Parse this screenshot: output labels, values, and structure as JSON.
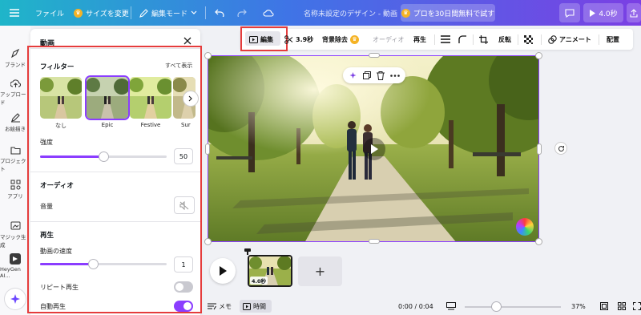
{
  "topbar": {
    "file_label": "ファイル",
    "resize_label": "サイズを変更",
    "edit_mode_label": "編集モード",
    "doc_title": "名称未設定のデザイン - 動画",
    "pro_label": "プロを30日間無料で試す",
    "play_duration": "4.0秒"
  },
  "rail": {
    "items": [
      {
        "label": "ブランド",
        "icon": "brand-icon"
      },
      {
        "label": "アップロード",
        "icon": "upload-icon"
      },
      {
        "label": "お絵描き",
        "icon": "draw-icon"
      },
      {
        "label": "プロジェクト",
        "icon": "folder-icon"
      },
      {
        "label": "アプリ",
        "icon": "apps-icon"
      },
      {
        "label": "マジック生成",
        "icon": "magic-media-icon"
      },
      {
        "label": "HeyGen AI...",
        "icon": "heygen-icon"
      }
    ]
  },
  "panel": {
    "title": "動画",
    "filter": {
      "heading": "フィルター",
      "see_all": "すべて表示",
      "thumbs": [
        {
          "label": "なし",
          "selected": false
        },
        {
          "label": "Epic",
          "selected": true
        },
        {
          "label": "Festive",
          "selected": false
        },
        {
          "label": "Sur",
          "selected": false
        }
      ],
      "intensity_label": "強度",
      "intensity_value": "50",
      "intensity_fraction": 0.5
    },
    "audio": {
      "heading": "オーディオ",
      "volume_label": "音量"
    },
    "playback": {
      "heading": "再生",
      "speed_label": "動画の速度",
      "speed_value": "1",
      "speed_fraction": 0.42,
      "repeat_label": "リピート再生",
      "repeat_on": false,
      "autoplay_label": "自動再生",
      "autoplay_on": true
    }
  },
  "context_toolbar": {
    "edit_label": "編集",
    "duration_label": "3.9秒",
    "bg_remove_label": "背景除去",
    "audio_label": "オーディオ",
    "playback_label": "再生",
    "flip_label": "反転",
    "animate_label": "アニメート",
    "arrange_label": "配置"
  },
  "timeline": {
    "clip_duration": "4.0秒",
    "add_label": "+"
  },
  "bottom": {
    "notes_label": "メモ",
    "time_label": "時間",
    "timecode": "0:00 / 0:04",
    "zoom_percent": "37%",
    "zoom_fraction": 0.33
  },
  "colors": {
    "accent": "#8b3dff",
    "selection_outline": "#e53c3c",
    "crown": "#f5b325"
  }
}
